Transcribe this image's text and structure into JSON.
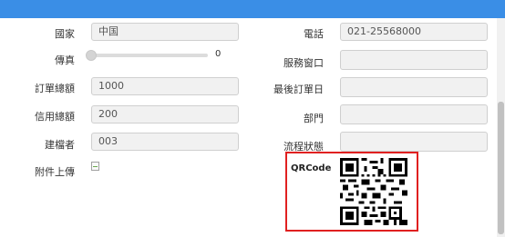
{
  "form": {
    "country": {
      "label": "國家",
      "value": "中国"
    },
    "phone": {
      "label": "電話",
      "value": "021-25568000"
    },
    "fax": {
      "label": "傳真",
      "slider_value": "0"
    },
    "service_window": {
      "label": "服務窗口",
      "value": ""
    },
    "order_total": {
      "label": "訂單總額",
      "value": "1000"
    },
    "last_order_date": {
      "label": "最後訂單日",
      "value": ""
    },
    "credit_total": {
      "label": "信用總額",
      "value": "200"
    },
    "department": {
      "label": "部門",
      "value": ""
    },
    "creator": {
      "label": "建檔者",
      "value": "003"
    },
    "workflow_status": {
      "label": "流程狀態",
      "value": ""
    },
    "attachment": {
      "label": "附件上傳"
    },
    "qrcode": {
      "label": "QRCode"
    }
  },
  "colors": {
    "topbar": "#3a8ee6",
    "qr_highlight": "#e02020"
  }
}
